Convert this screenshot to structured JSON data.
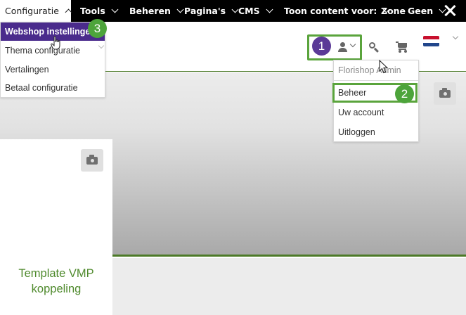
{
  "topbar": {
    "menu": [
      {
        "label": "Configuratie",
        "active": true
      },
      {
        "label": "Tools"
      },
      {
        "label": "Beheren"
      },
      {
        "label": "Pagina's"
      },
      {
        "label": "CMS"
      },
      {
        "label": "Toon content voor:"
      },
      {
        "label": "Zone"
      },
      {
        "label": "Geen"
      }
    ]
  },
  "config_dropdown": {
    "items": [
      {
        "label": "Webshop instellingen",
        "highlighted": true
      },
      {
        "label": "Thema configuratie"
      },
      {
        "label": "Vertalingen"
      },
      {
        "label": "Betaal configuratie"
      }
    ]
  },
  "account_dropdown": {
    "username": "Florishop Admin",
    "items": [
      {
        "label": "Beheer",
        "highlighted": true
      },
      {
        "label": "Uw account"
      },
      {
        "label": "Uitloggen"
      }
    ]
  },
  "annotations": {
    "step1": "1",
    "step2": "2",
    "step3": "3"
  },
  "card": {
    "title": "Template VMP koppeling"
  },
  "colors": {
    "topbar": "#000000",
    "highlight_purple": "#4a2b8c",
    "annotation_green": "#5aa43c",
    "accent_green": "#4c7a28",
    "title_green": "#4f8a2d"
  },
  "icons": [
    "user-icon",
    "search-icon",
    "cart-icon",
    "flag-nl-icon",
    "camera-icon",
    "close-icon",
    "cursor-icon",
    "hand-cursor-icon"
  ]
}
